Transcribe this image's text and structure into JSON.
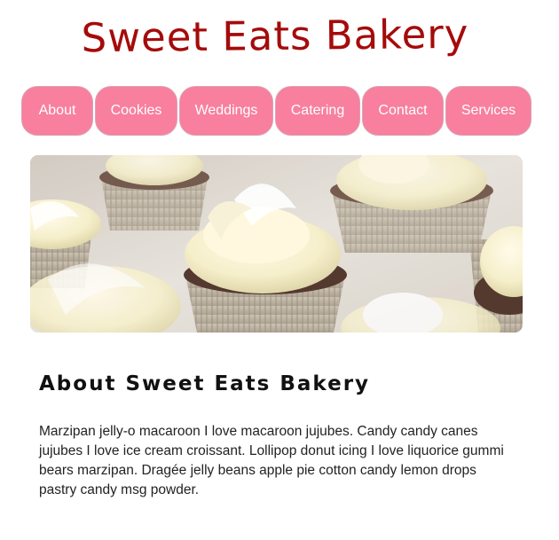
{
  "header": {
    "title": "Sweet Eats Bakery"
  },
  "nav": {
    "items": [
      {
        "label": "About"
      },
      {
        "label": "Cookies"
      },
      {
        "label": "Weddings"
      },
      {
        "label": "Catering"
      },
      {
        "label": "Contact"
      },
      {
        "label": "Services"
      }
    ]
  },
  "hero": {
    "image": "cupcakes-photo"
  },
  "about": {
    "heading": "About Sweet Eats Bakery",
    "body": "Marzipan jelly-o macaroon I love macaroon jujubes. Candy candy canes jujubes I love ice cream croissant. Lollipop donut icing I love liquorice gummi bears marzipan. Dragée jelly beans apple pie cotton candy lemon drops pastry candy msg powder."
  },
  "colors": {
    "title": "#a50b0b",
    "nav_button": "#f87f9e",
    "nav_text": "#ffffff",
    "body_text": "#222222"
  }
}
